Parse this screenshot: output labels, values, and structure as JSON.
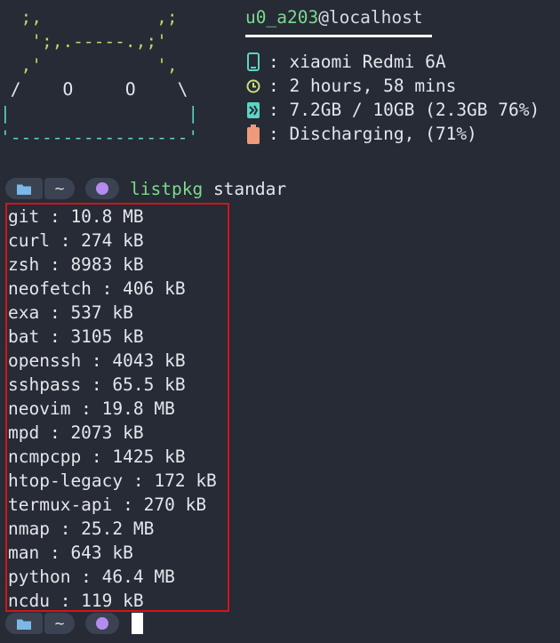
{
  "ascii_art": [
    "  ;,           ,;",
    "   ';,.-----.,;'",
    "  ,'           ',",
    " /    O     O    \\",
    "|                 |",
    "'-----------------'"
  ],
  "sysinfo": {
    "user": "u0_a203",
    "host": "@localhost",
    "rows": [
      {
        "icon": "phone-icon",
        "text": ": xiaomi Redmi 6A"
      },
      {
        "icon": "clock-icon",
        "text": ": 2 hours, 58 mins"
      },
      {
        "icon": "memory-icon",
        "text": ": 7.2GB / 10GB (2.3GB 76%)"
      },
      {
        "icon": "battery-icon",
        "text": ": Discharging, (71%)"
      }
    ]
  },
  "prompt": {
    "dir": "~",
    "command": "listpkg",
    "argument": "standar"
  },
  "packages": [
    "git : 10.8 MB",
    "curl : 274 kB",
    "zsh : 8983 kB",
    "neofetch : 406 kB",
    "exa : 537 kB",
    "bat : 3105 kB",
    "openssh : 4043 kB",
    "sshpass : 65.5 kB",
    "neovim : 19.8 MB",
    "mpd : 2073 kB",
    "ncmpcpp : 1425 kB",
    "htop-legacy : 172 kB",
    "termux-api : 270 kB",
    "nmap : 25.2 MB",
    "man : 643 kB",
    "python : 46.4 MB",
    "ncdu : 119 kB"
  ],
  "colors": {
    "background": "#262b35",
    "accent_green": "#7dd88f",
    "highlight_border": "#d41418",
    "battery": "#f09a7c"
  }
}
